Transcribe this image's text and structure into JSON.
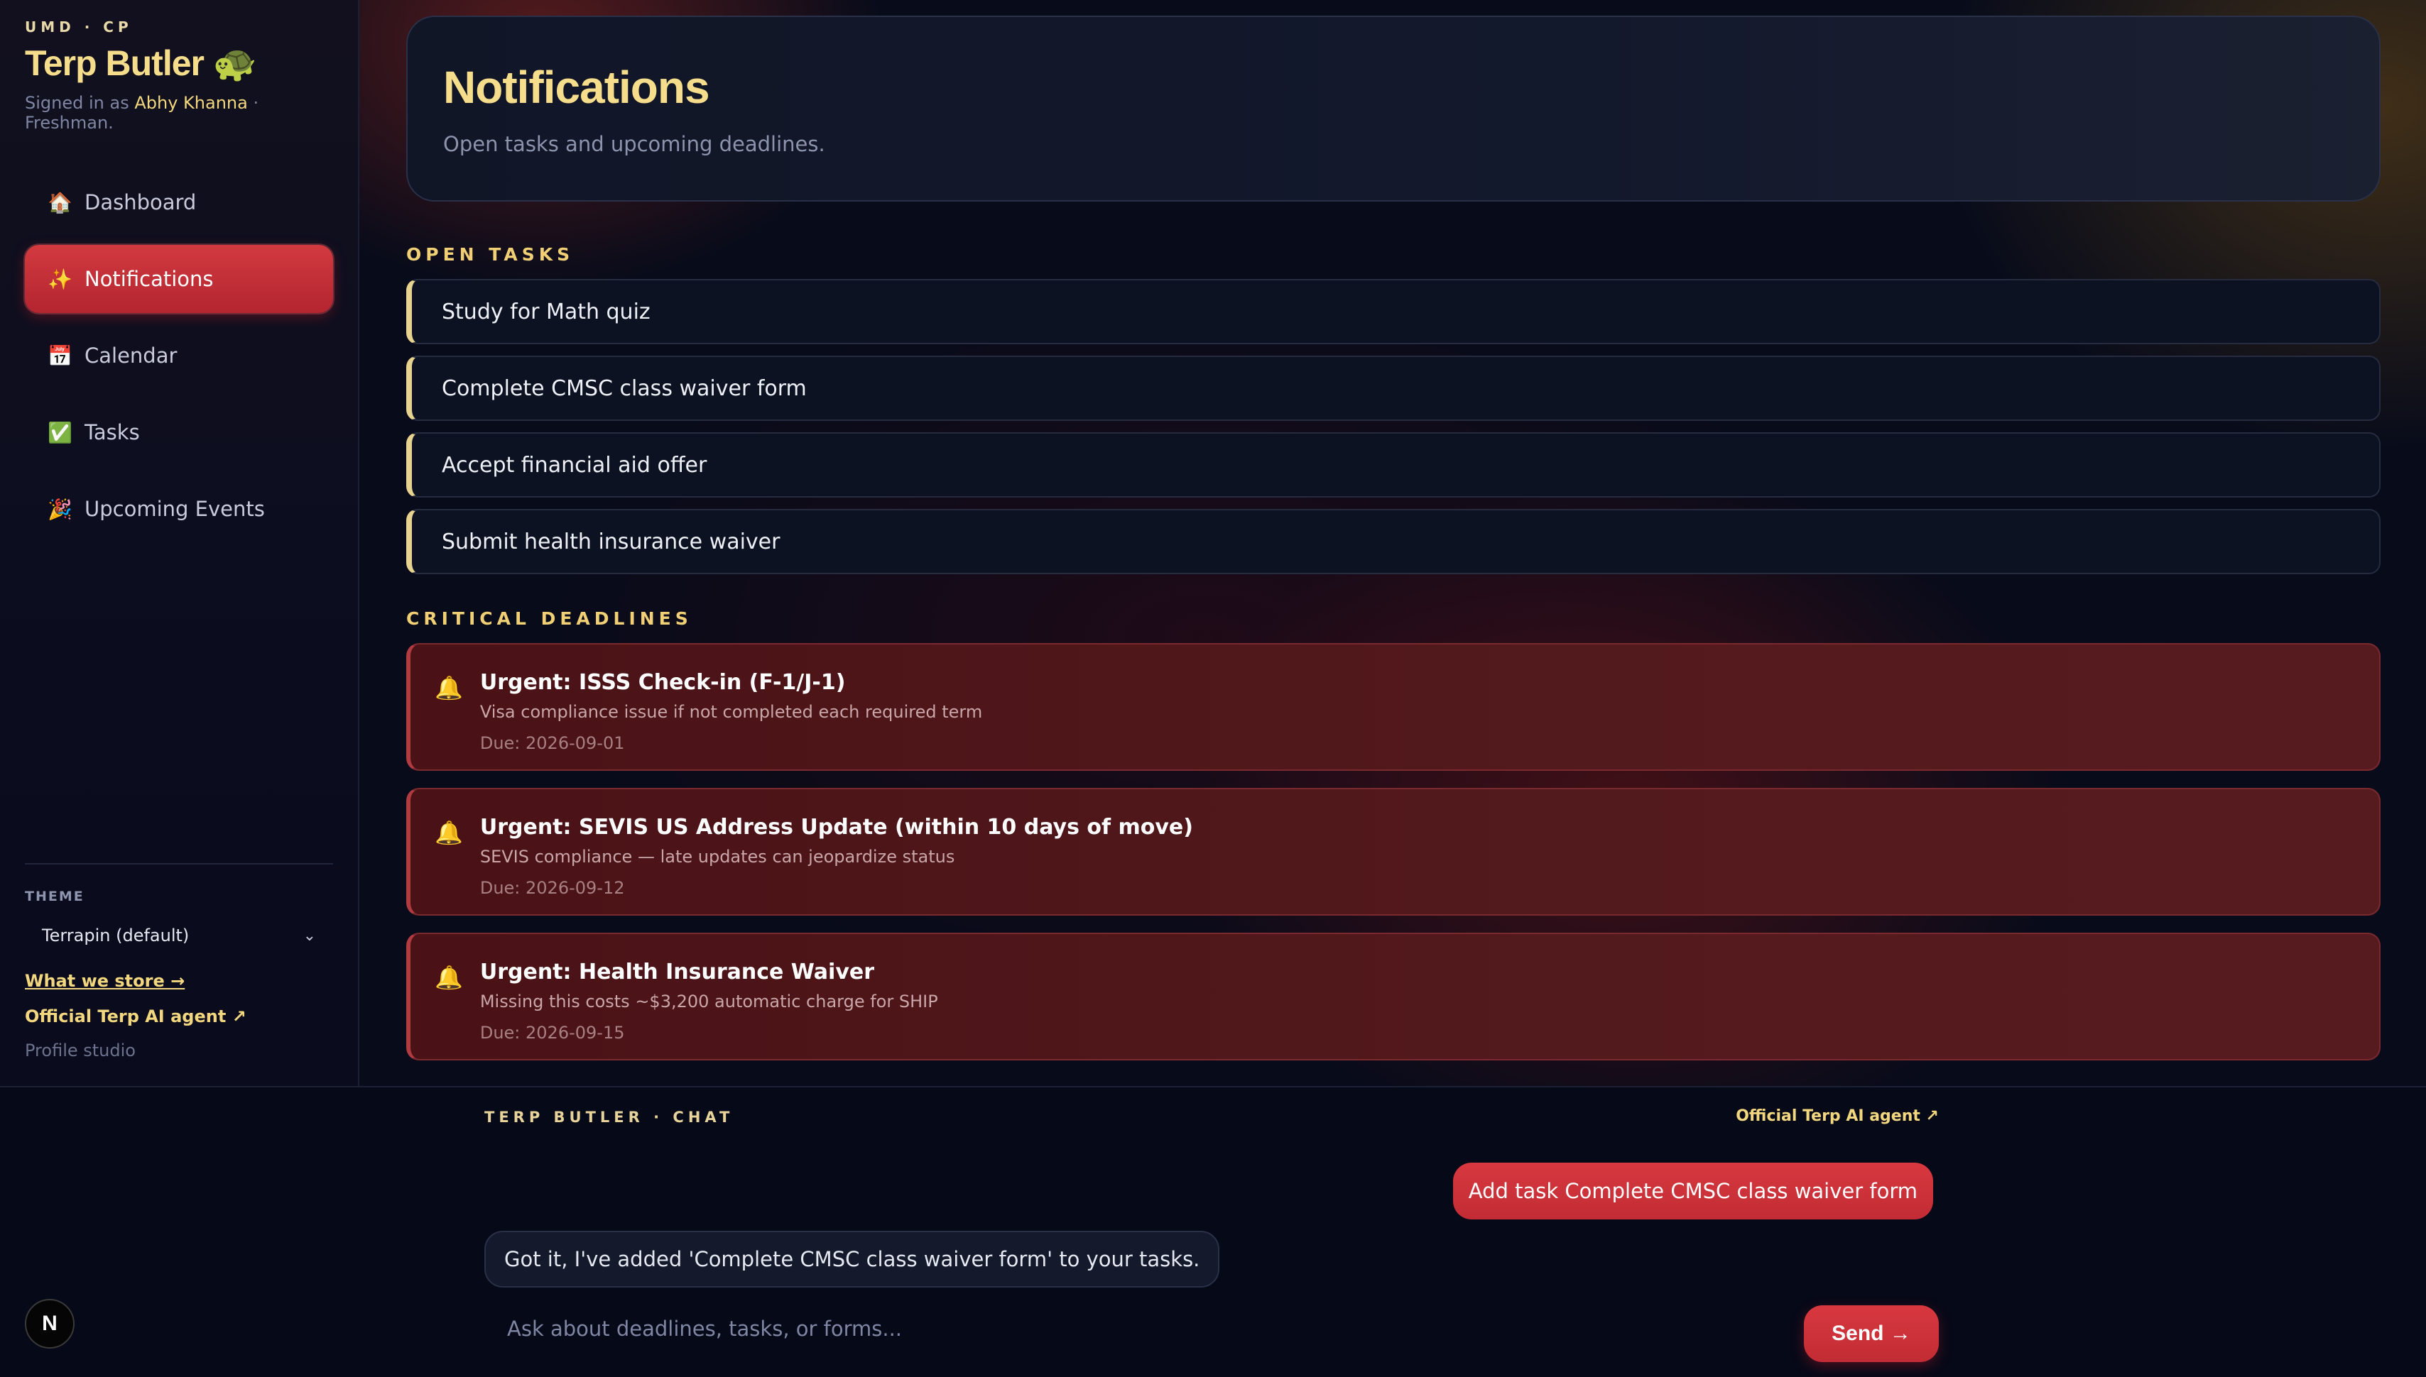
{
  "sidebar": {
    "eyebrow": "UMD · CP",
    "title": "Terp Butler",
    "title_emoji": "🐢",
    "signed_prefix": "Signed in as",
    "user_name": "Abhy Khanna",
    "user_suffix": "· Freshman.",
    "nav": [
      {
        "label": "Dashboard",
        "icon": "🏠",
        "active": false
      },
      {
        "label": "Notifications",
        "icon": "✨",
        "active": true
      },
      {
        "label": "Calendar",
        "icon": "📅",
        "active": false
      },
      {
        "label": "Tasks",
        "icon": "✅",
        "active": false
      },
      {
        "label": "Upcoming Events",
        "icon": "🎉",
        "active": false
      }
    ],
    "theme_label": "THEME",
    "theme_value": "Terrapin (default)",
    "link_store": "What we store →",
    "link_agent": "Official Terp AI agent ↗",
    "link_profile": "Profile studio"
  },
  "main": {
    "title": "Notifications",
    "subtitle": "Open tasks and upcoming deadlines.",
    "open_tasks_label": "OPEN TASKS",
    "tasks": [
      "Study for Math quiz",
      "Complete CMSC class waiver form",
      "Accept financial aid offer",
      "Submit health insurance waiver"
    ],
    "deadlines_label": "CRITICAL DEADLINES",
    "deadlines": [
      {
        "title": "Urgent: ISSS Check-in (F-1/J-1)",
        "desc": "Visa compliance issue if not completed each required term",
        "due": "Due: 2026-09-01"
      },
      {
        "title": "Urgent: SEVIS US Address Update (within 10 days of move)",
        "desc": "SEVIS compliance — late updates can jeopardize status",
        "due": "Due: 2026-09-12"
      },
      {
        "title": "Urgent: Health Insurance Waiver",
        "desc": "Missing this costs ~$3,200 automatic charge for SHIP",
        "due": "Due: 2026-09-15"
      }
    ]
  },
  "chat": {
    "label": "TERP BUTLER · CHAT",
    "agent_link": "Official Terp AI agent ↗",
    "user_message": "Add task Complete CMSC class waiver form",
    "bot_message": "Got it, I've added 'Complete CMSC class waiver form' to your tasks.",
    "input_placeholder": "Ask about deadlines, tasks, or forms...",
    "send_label": "Send →"
  },
  "badge": "N",
  "colors": {
    "accent": "#d23a3f",
    "gold": "#f6dd8c",
    "background": "#070b1a"
  }
}
